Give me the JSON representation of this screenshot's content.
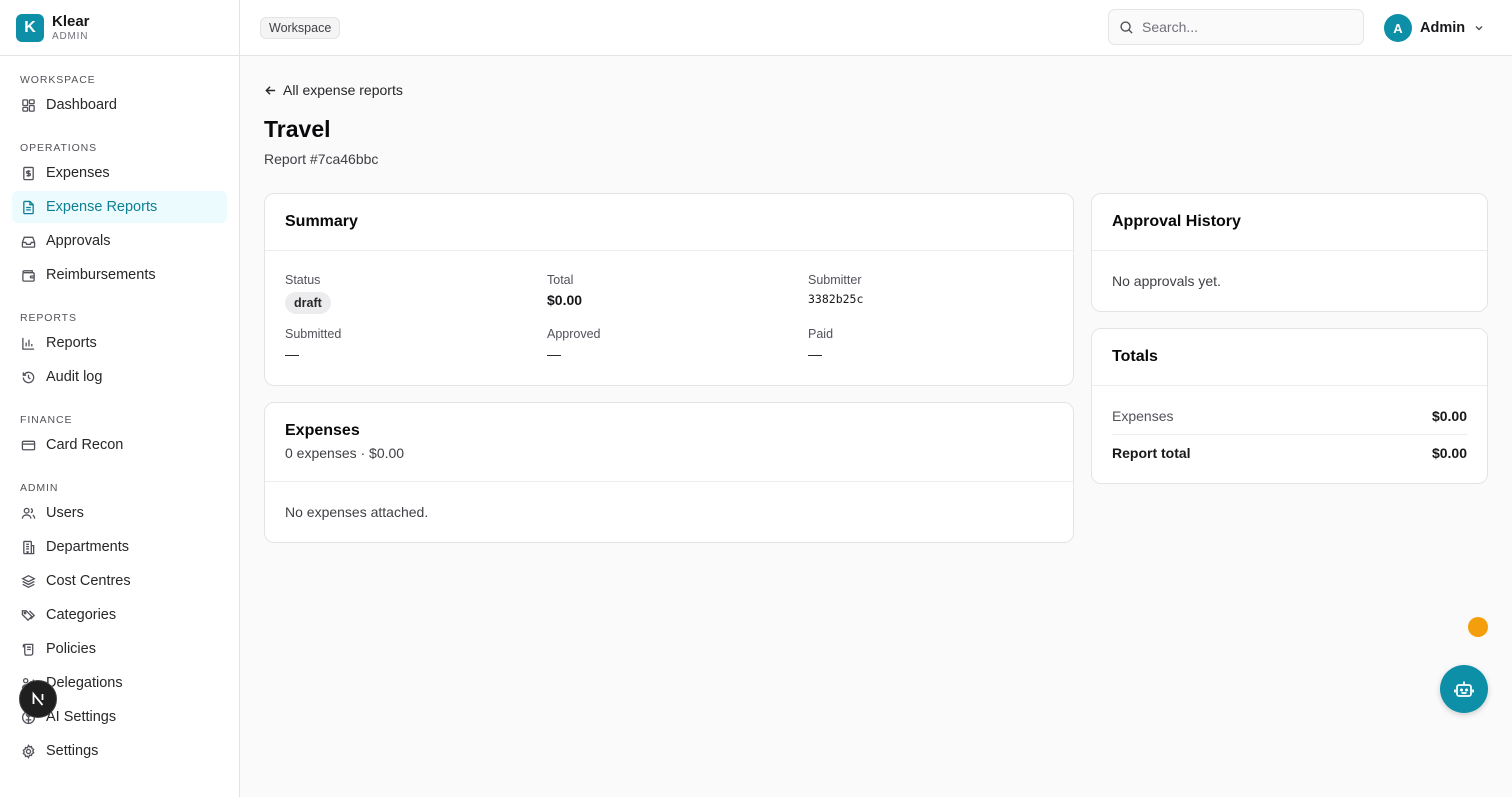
{
  "brand": {
    "logo_letter": "K",
    "name": "Klear",
    "subtitle": "ADMIN"
  },
  "sidebar": {
    "sections": [
      {
        "label": "WORKSPACE",
        "items": [
          {
            "label": "Dashboard",
            "icon": "grid-icon"
          }
        ]
      },
      {
        "label": "OPERATIONS",
        "items": [
          {
            "label": "Expenses",
            "icon": "receipt-dollar-icon"
          },
          {
            "label": "Expense Reports",
            "icon": "file-text-icon",
            "active": true
          },
          {
            "label": "Approvals",
            "icon": "inbox-icon"
          },
          {
            "label": "Reimbursements",
            "icon": "wallet-icon"
          }
        ]
      },
      {
        "label": "REPORTS",
        "items": [
          {
            "label": "Reports",
            "icon": "bar-chart-icon"
          },
          {
            "label": "Audit log",
            "icon": "history-icon"
          }
        ]
      },
      {
        "label": "FINANCE",
        "items": [
          {
            "label": "Card Recon",
            "icon": "credit-card-icon"
          }
        ]
      },
      {
        "label": "ADMIN",
        "items": [
          {
            "label": "Users",
            "icon": "users-icon"
          },
          {
            "label": "Departments",
            "icon": "building-icon"
          },
          {
            "label": "Cost Centres",
            "icon": "layers-icon"
          },
          {
            "label": "Categories",
            "icon": "tags-icon"
          },
          {
            "label": "Policies",
            "icon": "scroll-icon"
          },
          {
            "label": "Delegations",
            "icon": "delegation-icon"
          },
          {
            "label": "AI Settings",
            "icon": "brain-icon"
          },
          {
            "label": "Settings",
            "icon": "gear-icon"
          }
        ]
      }
    ]
  },
  "topbar": {
    "breadcrumb": "Workspace",
    "search_placeholder": "Search...",
    "user": {
      "initial": "A",
      "name": "Admin"
    }
  },
  "page": {
    "back_label": "All expense reports",
    "title": "Travel",
    "subtitle": "Report #7ca46bbc"
  },
  "summary": {
    "title": "Summary",
    "status_label": "Status",
    "status_value": "draft",
    "total_label": "Total",
    "total_value": "$0.00",
    "submitter_label": "Submitter",
    "submitter_value": "3382b25c",
    "submitted_label": "Submitted",
    "submitted_value": "—",
    "approved_label": "Approved",
    "approved_value": "—",
    "paid_label": "Paid",
    "paid_value": "—"
  },
  "expenses": {
    "title": "Expenses",
    "subtitle": "0 expenses · $0.00",
    "empty": "No expenses attached."
  },
  "approval_history": {
    "title": "Approval History",
    "empty": "No approvals yet."
  },
  "totals": {
    "title": "Totals",
    "expenses_label": "Expenses",
    "expenses_value": "$0.00",
    "report_total_label": "Report total",
    "report_total_value": "$0.00"
  },
  "colors": {
    "accent": "#0e8fa8",
    "active_bg": "#ecfbfd",
    "notification_dot": "#f59e0b"
  },
  "floating": {
    "assistant_icon": "robot-icon",
    "dev_badge_letter": "N"
  }
}
